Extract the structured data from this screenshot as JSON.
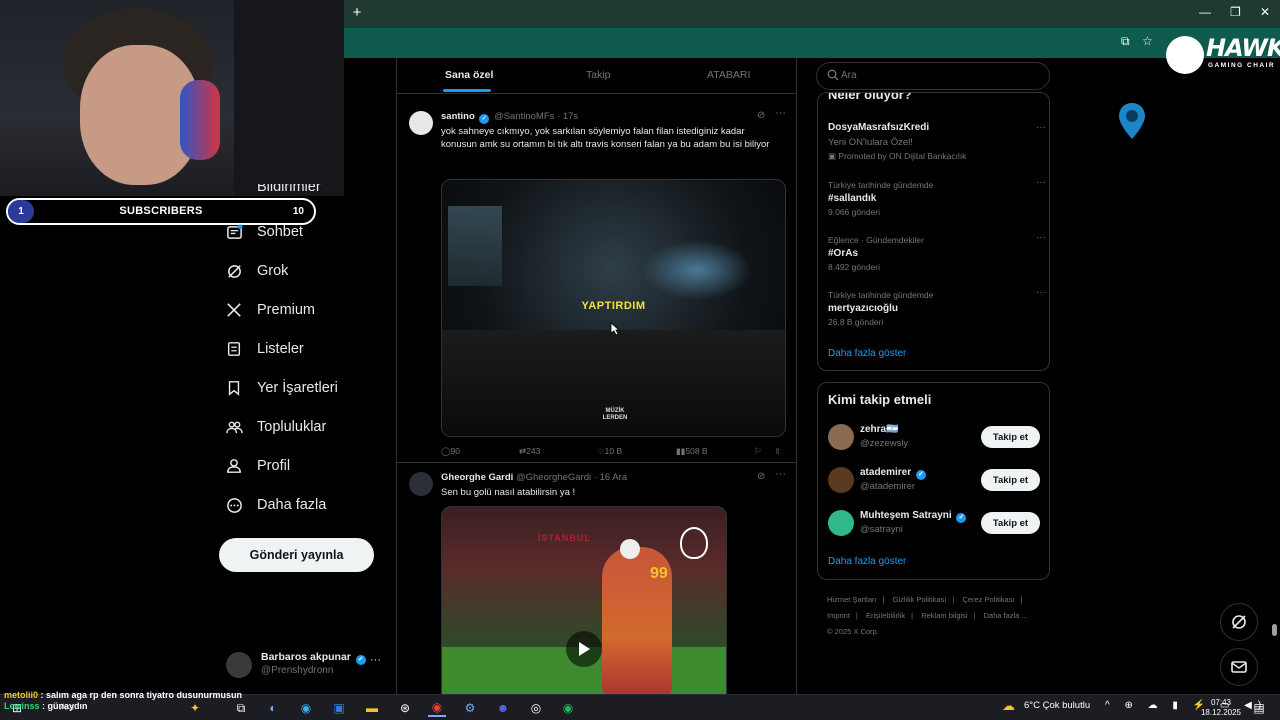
{
  "browser": {
    "new_tab_label": "+"
  },
  "stream_overlay": {
    "subscribers": {
      "current": "1",
      "label": "SUBSCRIBERS",
      "goal": "10"
    },
    "chat": [
      {
        "user": "metolii0",
        "message": "salım aga rp den sonra tiyatro dusunurmusun"
      },
      {
        "user": "Lewinss",
        "message": "günaydın"
      }
    ],
    "sponsor": {
      "brand": "HAWK",
      "tagline": "GAMING CHAIR"
    }
  },
  "nav": {
    "partial_label": "Bildirimler",
    "items": [
      {
        "label": "Sohbet",
        "icon": "chat-icon"
      },
      {
        "label": "Grok",
        "icon": "grok-icon"
      },
      {
        "label": "Premium",
        "icon": "x-logo-icon"
      },
      {
        "label": "Listeler",
        "icon": "list-icon"
      },
      {
        "label": "Yer İşaretleri",
        "icon": "bookmark-icon"
      },
      {
        "label": "Topluluklar",
        "icon": "communities-icon"
      },
      {
        "label": "Profil",
        "icon": "profile-icon"
      },
      {
        "label": "Daha fazla",
        "icon": "more-circle-icon"
      }
    ],
    "post_button": "Gönderi yayınla",
    "account": {
      "name": "Barbaros akpunar",
      "handle": "@Prenshydronn",
      "more": "···"
    }
  },
  "timeline": {
    "tabs": [
      "Sana özel",
      "Takip",
      "ATABARI"
    ],
    "active_tab": 0,
    "tweets": [
      {
        "name": "santino",
        "handle": "@SantinoMFs",
        "time": "17s",
        "text": "yok sahneye cıkmıyo, yok sarkılan söylemiyo falan filan istediginiz kadar konusun amk su ortamın bi tık altı travis konseri falan ya bu adam bu isi biliyor",
        "media_caption": "YAPTIRDIM",
        "media_watermark": "MÜZİK LERDEN",
        "stats": {
          "replies": "90",
          "reposts": "243",
          "likes": "10 B",
          "views": "508 B"
        }
      },
      {
        "name": "Gheorghe Gardi",
        "handle": "@GheorgheGardi",
        "time": "16 Ara",
        "text": "Sen bu golü nasıl atabilirsin ya !",
        "media_banner": "İSTANBUL",
        "jersey_number": "99"
      }
    ]
  },
  "right": {
    "search_placeholder": "Ara",
    "trends_title": "Neler oluyor?",
    "promoted": {
      "title": "DosyaMasrafsızKredi",
      "subtitle": "Yeni ON'lulara Özel!",
      "by": "Promoted by ON Dijital Bankacılık"
    },
    "trends": [
      {
        "context": "Türkiye tarihinde gündemde",
        "title": "#sallandık",
        "count": "9.066 gönderi"
      },
      {
        "context": "Eğlence · Gündemdekiler",
        "title": "#OrAs",
        "count": "8.492 gönderi"
      },
      {
        "context": "Türkiye tarihinde gündemde",
        "title": "mertyazıcıoğlu",
        "count": "26,8 B gönderi"
      }
    ],
    "show_more": "Daha fazla göster",
    "who_title": "Kimi takip etmeli",
    "who": [
      {
        "name": "zehra🇦🇷",
        "handle": "@zezewsly",
        "verified": false,
        "button": "Takip et"
      },
      {
        "name": "atademirer",
        "handle": "@atademirer",
        "verified": true,
        "button": "Takip et"
      },
      {
        "name": "Muhteşem Satrayni",
        "handle": "@satrayni",
        "verified": true,
        "button": "Takip et"
      }
    ],
    "who_more": "Daha fazla göster",
    "footer_links": [
      "Hizmet Şartları",
      "Gizlilik Politikası",
      "Çerez Politikası",
      "Imprint",
      "Erişilebilirlik",
      "Reklam bilgisi",
      "Daha fazla ..."
    ],
    "copyright": "© 2025 X Corp."
  },
  "taskbar": {
    "search_text": "Ara",
    "weather": "6°C  Çok bulutlu",
    "time": "07:43",
    "date": "18.12.2025"
  },
  "colors": {
    "accent": "#1d9bf0",
    "background": "#000000",
    "border": "#2f3336",
    "muted": "#71767b",
    "chrome": "#0f5b4d"
  }
}
